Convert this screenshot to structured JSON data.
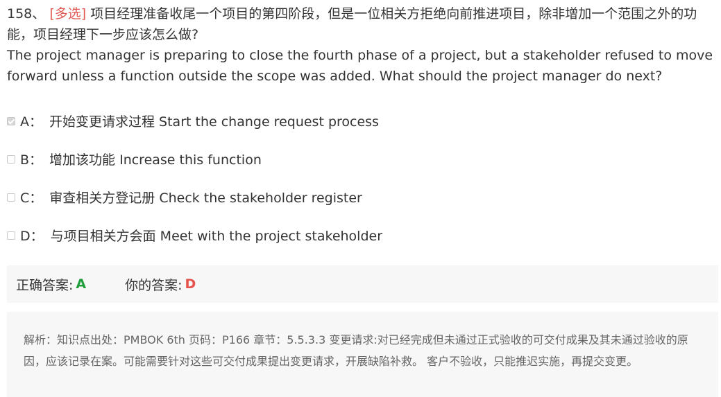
{
  "question": {
    "number": "158、",
    "tag": "[多选]",
    "text_cn": "项目经理准备收尾一个项目的第四阶段，但是一位相关方拒绝向前推进项目，除非增加一个范围之外的功能，项目经理下一步应该怎么做?",
    "text_en": "The project manager is preparing to close the fourth phase of a project, but a stakeholder refused to move forward unless a function outside the scope was added. What should the project manager do next?"
  },
  "options": [
    {
      "letter": "A：",
      "text": "开始变更请求过程 Start the change request process",
      "checked": true
    },
    {
      "letter": "B：",
      "text": "增加该功能 Increase this function",
      "checked": false
    },
    {
      "letter": "C：",
      "text": "审查相关方登记册 Check the stakeholder register",
      "checked": false
    },
    {
      "letter": "D：",
      "text": "与项目相关方会面 Meet with the project stakeholder",
      "checked": false
    }
  ],
  "answer": {
    "correct_label": "正确答案:",
    "correct_value": "A",
    "correct_color": "#1f9e3a",
    "your_label": "你的答案:",
    "your_value": "D",
    "your_color": "#e5534b"
  },
  "analysis": {
    "text": "解析：知识点出处：PMBOK 6th 页码：P166 章节：5.5.3.3 变更请求:对已经完成但未通过正式验收的可交付成果及其未通过验收的原因，应该记录在案。可能需要针对这些可交付成果提出变更请求，开展缺陷补救。 客户不验收，只能推迟实施，再提交变更。"
  }
}
